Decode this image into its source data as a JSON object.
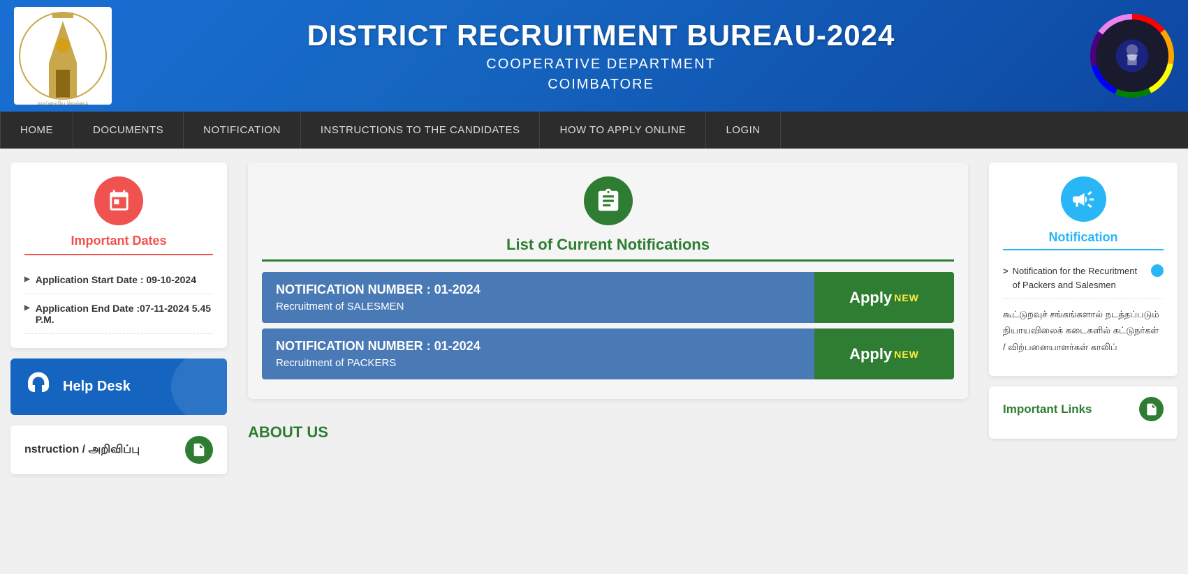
{
  "header": {
    "title": "DISTRICT RECRUITMENT BUREAU-2024",
    "subtitle1": "COOPERATIVE DEPARTMENT",
    "subtitle2": "COIMBATORE"
  },
  "nav": {
    "items": [
      {
        "id": "home",
        "label": "HOME"
      },
      {
        "id": "documents",
        "label": "DOCUMENTS"
      },
      {
        "id": "notification",
        "label": "NOTIFICATION"
      },
      {
        "id": "instructions",
        "label": "INSTRUCTIONS TO THE CANDIDATES"
      },
      {
        "id": "how-to-apply",
        "label": "HOW TO APPLY ONLINE"
      },
      {
        "id": "login",
        "label": "LOGIN"
      }
    ]
  },
  "left": {
    "important_dates_title": "Important Dates",
    "dates": [
      {
        "label": "Application Start Date : 09-10-2024"
      },
      {
        "label": "Application End Date :07-11-2024 5.45 P.M."
      }
    ],
    "helpdesk_label": "Help Desk",
    "instruction_label": "nstruction / அறிவிப்பு"
  },
  "center": {
    "notifications_title": "List of Current Notifications",
    "rows": [
      {
        "number": "NOTIFICATION NUMBER : 01-2024",
        "desc": "Recruitment of SALESMEN",
        "apply_label": "Apply",
        "apply_badge": "NEW"
      },
      {
        "number": "NOTIFICATION NUMBER : 01-2024",
        "desc": "Recruitment of PACKERS",
        "apply_label": "Apply",
        "apply_badge": "NEW"
      }
    ],
    "about_title": "ABOUT US"
  },
  "right": {
    "notification_title": "Notification",
    "notif_items": [
      {
        "text": "Notification for the Recuritment of Packers and Salesmen",
        "has_globe": true
      }
    ],
    "tamil_text": "கூட்டுறவுச் சங்கங்களால் நடத்தப்படும் நியாயவிலைக் கடைகளில் கட்டுநர்கள் / விற்பனையாளர்கள் காலிப்",
    "important_links_title": "Important Links"
  }
}
